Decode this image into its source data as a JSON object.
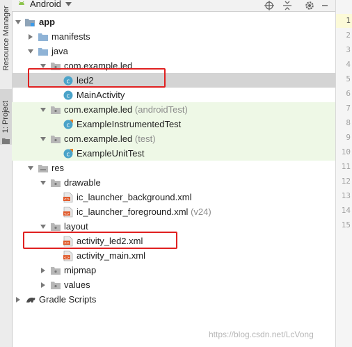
{
  "tool_strip": {
    "resource_manager_label": "Resource Manager",
    "project_label": "1: Project"
  },
  "toolbar": {
    "view_label": "Android"
  },
  "tree": {
    "rows": [
      {
        "label": "app",
        "suffix": "",
        "icon": "module-folder-icon"
      },
      {
        "label": "manifests",
        "suffix": "",
        "icon": "folder-icon"
      },
      {
        "label": "java",
        "suffix": "",
        "icon": "folder-icon"
      },
      {
        "label": "com.example.led",
        "suffix": "",
        "icon": "package-icon"
      },
      {
        "label": "led2",
        "suffix": "",
        "icon": "class-icon"
      },
      {
        "label": "MainActivity",
        "suffix": "",
        "icon": "class-icon"
      },
      {
        "label": "com.example.led",
        "suffix": "(androidTest)",
        "icon": "package-icon"
      },
      {
        "label": "ExampleInstrumentedTest",
        "suffix": "",
        "icon": "test-class-icon"
      },
      {
        "label": "com.example.led",
        "suffix": "(test)",
        "icon": "package-icon"
      },
      {
        "label": "ExampleUnitTest",
        "suffix": "",
        "icon": "test-class-icon"
      },
      {
        "label": "res",
        "suffix": "",
        "icon": "folder-icon"
      },
      {
        "label": "drawable",
        "suffix": "",
        "icon": "folder-icon"
      },
      {
        "label": "ic_launcher_background.xml",
        "suffix": "",
        "icon": "xml-file-icon"
      },
      {
        "label": "ic_launcher_foreground.xml",
        "suffix": "(v24)",
        "icon": "xml-file-icon"
      },
      {
        "label": "layout",
        "suffix": "",
        "icon": "folder-icon"
      },
      {
        "label": "activity_led2.xml",
        "suffix": "",
        "icon": "xml-file-icon"
      },
      {
        "label": "activity_main.xml",
        "suffix": "",
        "icon": "xml-file-icon"
      },
      {
        "label": "mipmap",
        "suffix": "",
        "icon": "folder-icon"
      },
      {
        "label": "values",
        "suffix": "",
        "icon": "folder-icon"
      },
      {
        "label": "Gradle Scripts",
        "suffix": "",
        "icon": "gradle-icon"
      }
    ]
  },
  "gutter": {
    "line_numbers": [
      "1",
      "2",
      "3",
      "4",
      "5",
      "6",
      "7",
      "8",
      "9",
      "10",
      "11",
      "12",
      "13",
      "14",
      "15"
    ]
  },
  "watermark": "https://blog.csdn.net/LcVong"
}
